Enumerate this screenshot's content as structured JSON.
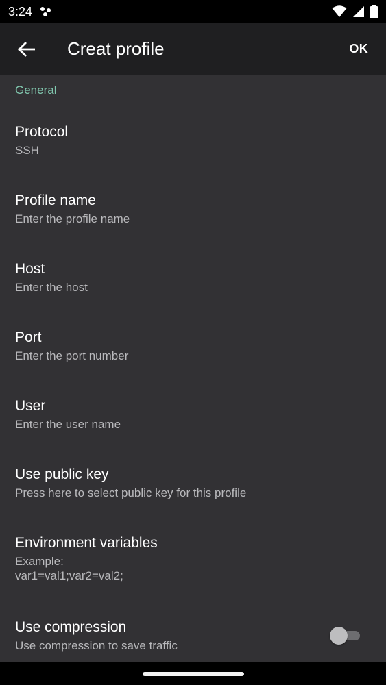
{
  "status": {
    "time": "3:24"
  },
  "appbar": {
    "title": "Creat profile",
    "ok_label": "OK"
  },
  "section": {
    "header": "General"
  },
  "prefs": [
    {
      "title": "Protocol",
      "summary": "SSH"
    },
    {
      "title": "Profile name",
      "summary": "Enter the profile name"
    },
    {
      "title": "Host",
      "summary": "Enter the host"
    },
    {
      "title": "Port",
      "summary": "Enter the port number"
    },
    {
      "title": "User",
      "summary": "Enter the user name"
    },
    {
      "title": "Use public key",
      "summary": "Press here to select public key for this profile"
    },
    {
      "title": "Environment variables",
      "summary": "Example:\nvar1=val1;var2=val2;"
    },
    {
      "title": "Use compression",
      "summary": "Use compression to save traffic"
    }
  ],
  "compression_enabled": false,
  "colors": {
    "accent": "#81c7ae",
    "background": "#323134",
    "appbar": "#1f1f21"
  }
}
